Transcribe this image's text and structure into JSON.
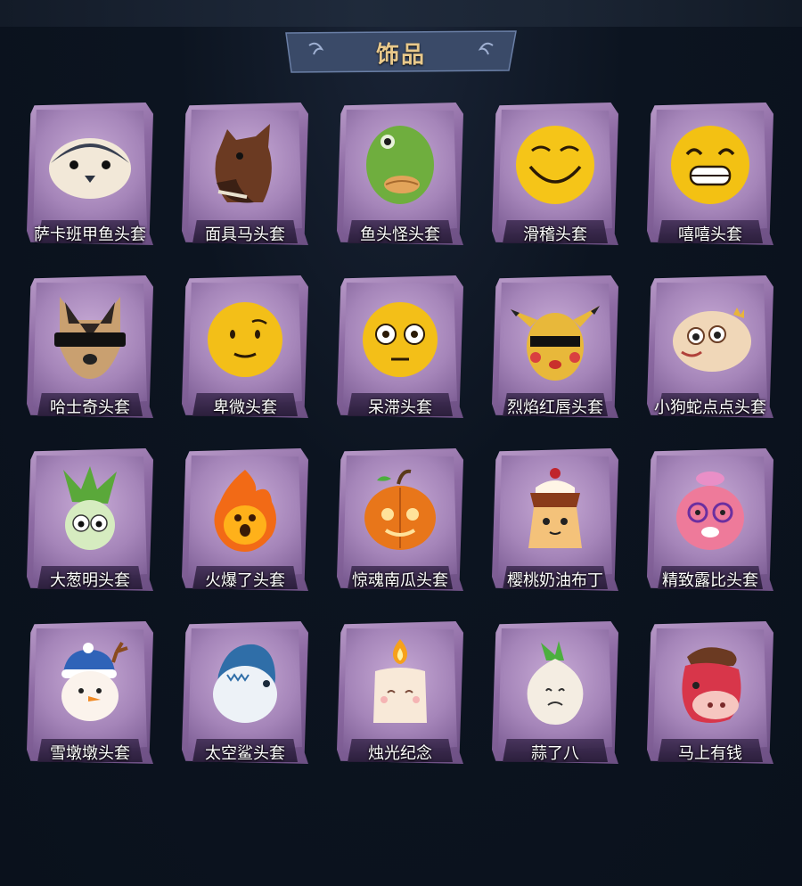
{
  "title": "饰品",
  "items": [
    {
      "label": "萨卡班甲鱼头套",
      "icon": "fish-mask-icon"
    },
    {
      "label": "面具马头套",
      "icon": "horse-mask-icon"
    },
    {
      "label": "鱼头怪头套",
      "icon": "fishhead-mask-icon"
    },
    {
      "label": "滑稽头套",
      "icon": "smirk-emoji-mask-icon"
    },
    {
      "label": "嘻嘻头套",
      "icon": "grin-emoji-mask-icon"
    },
    {
      "label": "哈士奇头套",
      "icon": "husky-mask-icon"
    },
    {
      "label": "卑微头套",
      "icon": "humble-emoji-mask-icon"
    },
    {
      "label": "呆滞头套",
      "icon": "dazed-emoji-mask-icon"
    },
    {
      "label": "烈焰红唇头套",
      "icon": "pikachu-mask-icon"
    },
    {
      "label": "小狗蛇点点头套",
      "icon": "snake-mask-icon"
    },
    {
      "label": "大葱明头套",
      "icon": "scallion-mask-icon"
    },
    {
      "label": "火爆了头套",
      "icon": "fire-mask-icon"
    },
    {
      "label": "惊魂南瓜头套",
      "icon": "pumpkin-mask-icon"
    },
    {
      "label": "樱桃奶油布丁",
      "icon": "pudding-mask-icon"
    },
    {
      "label": "精致露比头套",
      "icon": "ruby-mask-icon"
    },
    {
      "label": "雪墩墩头套",
      "icon": "snowman-mask-icon"
    },
    {
      "label": "太空鲨头套",
      "icon": "shark-mask-icon"
    },
    {
      "label": "烛光纪念",
      "icon": "candle-mask-icon"
    },
    {
      "label": "蒜了八",
      "icon": "garlic-mask-icon"
    },
    {
      "label": "马上有钱",
      "icon": "horse-red-mask-icon"
    }
  ]
}
